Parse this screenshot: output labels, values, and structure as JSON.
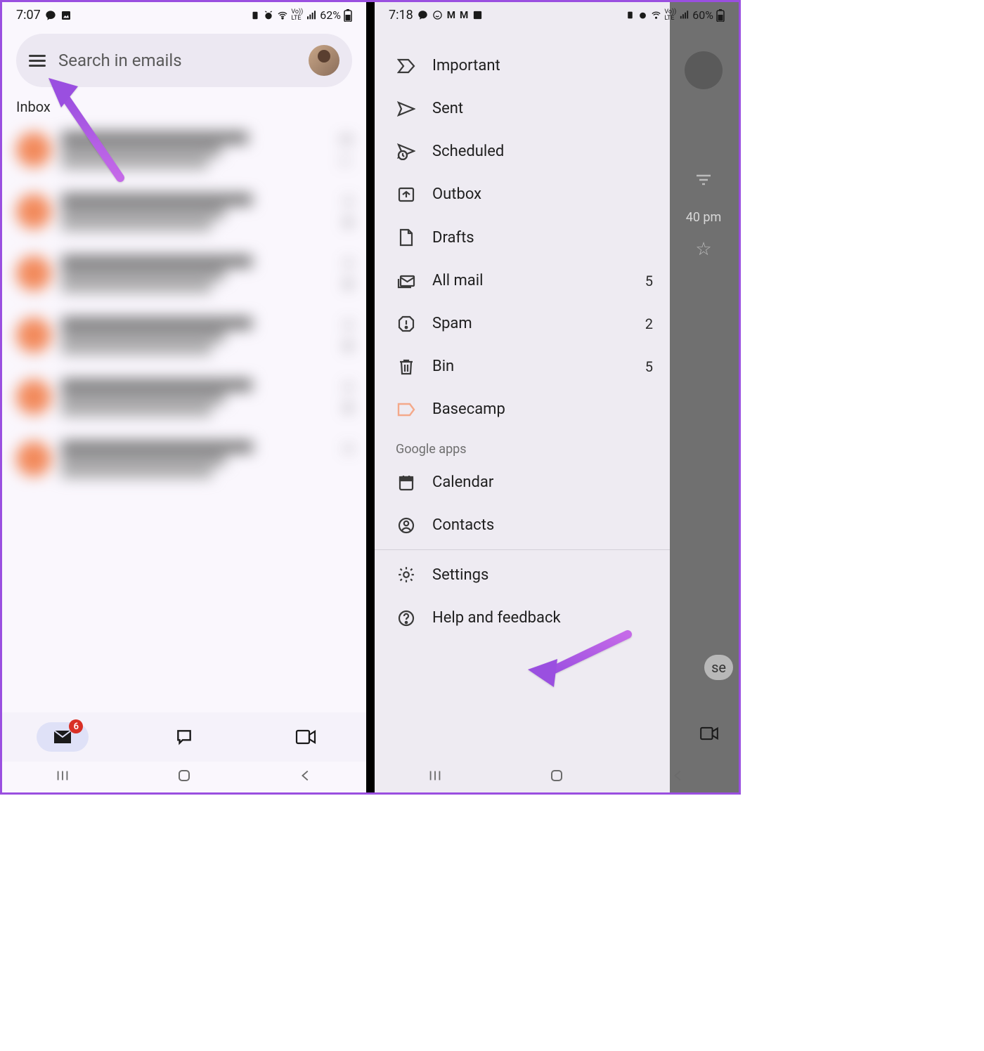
{
  "left": {
    "status": {
      "time": "7:07",
      "battery": "62%"
    },
    "search": {
      "placeholder": "Search in emails"
    },
    "section": {
      "label": "Inbox"
    },
    "emails": [
      {
        "time": "m"
      },
      {
        "time": "n"
      },
      {
        "time": "n"
      },
      {
        "time": "n"
      },
      {
        "time": "n"
      },
      {
        "time": "n"
      }
    ],
    "bottom_nav": {
      "mail_badge": "6"
    }
  },
  "right": {
    "status": {
      "time": "7:18",
      "battery": "60%"
    },
    "drawer": {
      "items": [
        {
          "icon": "important",
          "label": "Important"
        },
        {
          "icon": "sent",
          "label": "Sent"
        },
        {
          "icon": "scheduled",
          "label": "Scheduled"
        },
        {
          "icon": "outbox",
          "label": "Outbox"
        },
        {
          "icon": "drafts",
          "label": "Drafts"
        },
        {
          "icon": "allmail",
          "label": "All mail",
          "count": "5"
        },
        {
          "icon": "spam",
          "label": "Spam",
          "count": "2"
        },
        {
          "icon": "bin",
          "label": "Bin",
          "count": "5"
        },
        {
          "icon": "label",
          "label": "Basecamp",
          "color": "#f4a98a"
        }
      ],
      "section": "Google apps",
      "apps": [
        {
          "icon": "calendar",
          "label": "Calendar"
        },
        {
          "icon": "contacts",
          "label": "Contacts"
        }
      ],
      "footer": [
        {
          "icon": "settings",
          "label": "Settings"
        },
        {
          "icon": "help",
          "label": "Help and feedback"
        }
      ]
    },
    "peek": {
      "time": "40 pm",
      "se": "se"
    }
  }
}
